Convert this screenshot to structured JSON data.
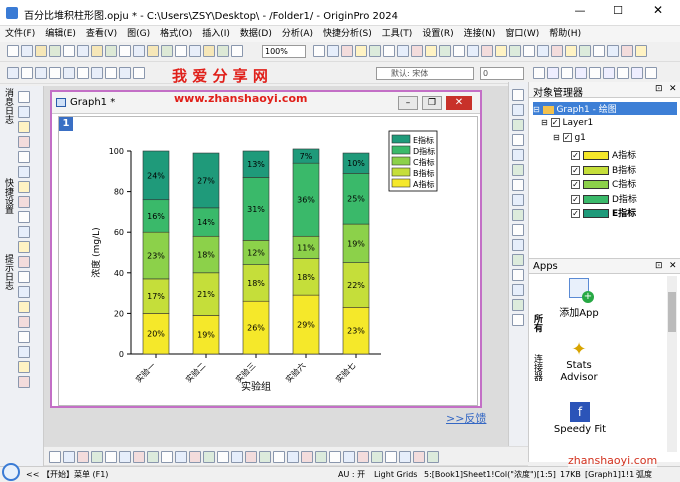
{
  "window": {
    "title": "百分比堆积柱形图.opju * - C:\\Users\\ZSY\\Desktop\\ - /Folder1/ - OriginPro 2024"
  },
  "menu": [
    "文件(F)",
    "编辑(E)",
    "查看(V)",
    "图(G)",
    "格式(O)",
    "插入(I)",
    "数据(D)",
    "分析(A)",
    "快捷分析(S)",
    "工具(T)",
    "设置(R)",
    "连接(N)",
    "窗口(W)",
    "帮助(H)"
  ],
  "toolbar": {
    "zoom": "100%",
    "font_name": "默认: 宋体",
    "font_size": "0"
  },
  "watermark": {
    "text": "我 爱 分 享 网",
    "url": "www.zhanshaoyi.com"
  },
  "left_tabs": [
    "消息日志",
    "快捷设置",
    "提示日志"
  ],
  "graph": {
    "title": "Graph1 *",
    "layer_number": "1",
    "feedback_link": ">>反馈"
  },
  "chart_data": {
    "type": "bar",
    "stacked": true,
    "categories": [
      "实验一",
      "实验二",
      "实验三",
      "实验六",
      "实验七"
    ],
    "xlabel": "实验组",
    "ylabel": "浓度 (mg/L)",
    "ylim": [
      0,
      100
    ],
    "yticks": [
      "0",
      "20",
      "40",
      "60",
      "80",
      "100"
    ],
    "legend_position": "top-right",
    "series": [
      {
        "name": "A指标",
        "color": "#f5e82a",
        "values": [
          20,
          19,
          26,
          29,
          23
        ],
        "labels": [
          "20%",
          "19%",
          "26%",
          "29%",
          "23%"
        ]
      },
      {
        "name": "B指标",
        "color": "#c5de3a",
        "values": [
          17,
          21,
          18,
          18,
          22
        ],
        "labels": [
          "17%",
          "21%",
          "18%",
          "18%",
          "22%"
        ]
      },
      {
        "name": "C指标",
        "color": "#8cd14a",
        "values": [
          23,
          18,
          12,
          11,
          19
        ],
        "labels": [
          "23%",
          "18%",
          "12%",
          "11%",
          "19%"
        ]
      },
      {
        "name": "D指标",
        "color": "#3ab96a",
        "values": [
          16,
          14,
          31,
          36,
          25
        ],
        "labels": [
          "16%",
          "14%",
          "31%",
          "36%",
          "25%"
        ]
      },
      {
        "name": "E指标",
        "color": "#1f9a7a",
        "values": [
          24,
          27,
          13,
          7,
          10
        ],
        "labels": [
          "24%",
          "27%",
          "13%",
          "7%",
          "10%"
        ]
      }
    ]
  },
  "object_manager": {
    "title": "对象管理器",
    "graph_item": "Graph1 - 绘图",
    "layer_item": "Layer1",
    "group_item": "g1",
    "plots": [
      "A指标",
      "B指标",
      "C指标",
      "D指标",
      "E指标"
    ],
    "plot_colors": [
      "#f5e82a",
      "#c5de3a",
      "#8cd14a",
      "#3ab96a",
      "#1f9a7a"
    ]
  },
  "apps": {
    "title": "Apps",
    "items": [
      "添加App",
      "Stats Advisor",
      "Speedy Fit"
    ],
    "tabs": [
      "所有",
      "连接器"
    ]
  },
  "statusbar": {
    "start": "<< 【开始】菜单 (F1)",
    "au": "AU : 开",
    "grids": "Light Grids",
    "info": "5:[Book1]Sheet1!Col(\"浓度\")[1:5]",
    "size": "17KB",
    "graph_ref": "[Graph1]1!1",
    "unit": "弧度",
    "site": "zhanshaoyi.com"
  }
}
